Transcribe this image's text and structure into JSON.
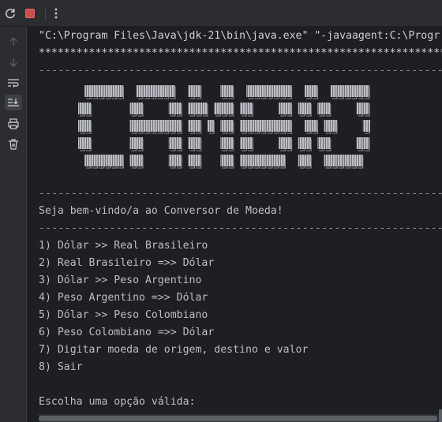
{
  "toolbar": {
    "icons": [
      "rerun-icon",
      "stop-icon",
      "more-options-icon"
    ],
    "stop_color": "#c94f4f"
  },
  "sidebar": {
    "icons": [
      "scroll-up-icon",
      "scroll-down-icon",
      "soft-wrap-icon",
      "scroll-to-end-icon",
      "print-icon",
      "clear-icon"
    ]
  },
  "console": {
    "command": "\"C:\\Program Files\\Java\\jdk-21\\bin\\java.exe\" \"-javaagent:C:\\Progr",
    "stars": "*****************************************************************",
    "dashes": "-----------------------------------------------------------------",
    "welcome": "Seja bem-vindo/a ao Conversor de Moeda!",
    "menu": [
      "1) Dólar >> Real Brasileiro",
      "2) Real Brasileiro =>> Dólar",
      "3) Dólar >> Peso Argentino",
      "4) Peso Argentino =>> Dólar",
      "5) Dólar >> Peso Colombiano",
      "6) Peso Colombiano =>> Dólar",
      "7) Digitar moeda de origem, destino e valor",
      "8) Sair"
    ],
    "prompt": "Escolha uma opção válida:",
    "ascii_logo": "CAMBIO"
  },
  "colors": {
    "background": "#1e1f22",
    "panel": "#2b2d30",
    "text": "#bcbec4"
  }
}
